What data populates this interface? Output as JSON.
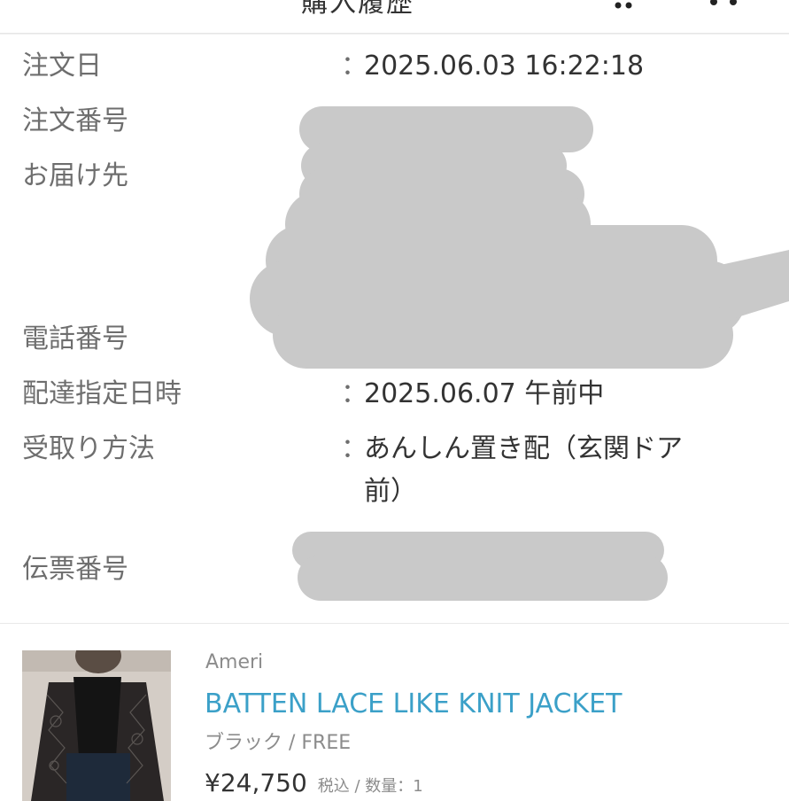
{
  "header": {
    "title": "購入履歴",
    "cart_icon": "cart-icon",
    "menu_icon": "more-dots-icon"
  },
  "order": {
    "colon": "：",
    "rows": [
      {
        "label": "注文日",
        "value": "2025.06.03 16:22:18"
      },
      {
        "label": "注文番号",
        "value": ""
      },
      {
        "label": "お届け先",
        "value": ""
      },
      {
        "label": "電話番号",
        "value": ""
      },
      {
        "label": "配達指定日時",
        "value": "2025.06.07 午前中"
      },
      {
        "label": "受取り方法",
        "value_line1": "あんしん置き配（玄関ドア",
        "value_line2": "前）"
      },
      {
        "label": "伝票番号",
        "value": ""
      }
    ]
  },
  "product": {
    "brand": "Ameri",
    "name": "BATTEN LACE LIKE KNIT JACKET",
    "variant": "ブラック / FREE",
    "price": "¥24,750",
    "price_meta": "税込 / 数量：1",
    "link_color": "#3ba0c8"
  },
  "colors": {
    "redaction": "#c9c9c9",
    "label_text": "#6e6e6e",
    "value_text": "#333333"
  }
}
